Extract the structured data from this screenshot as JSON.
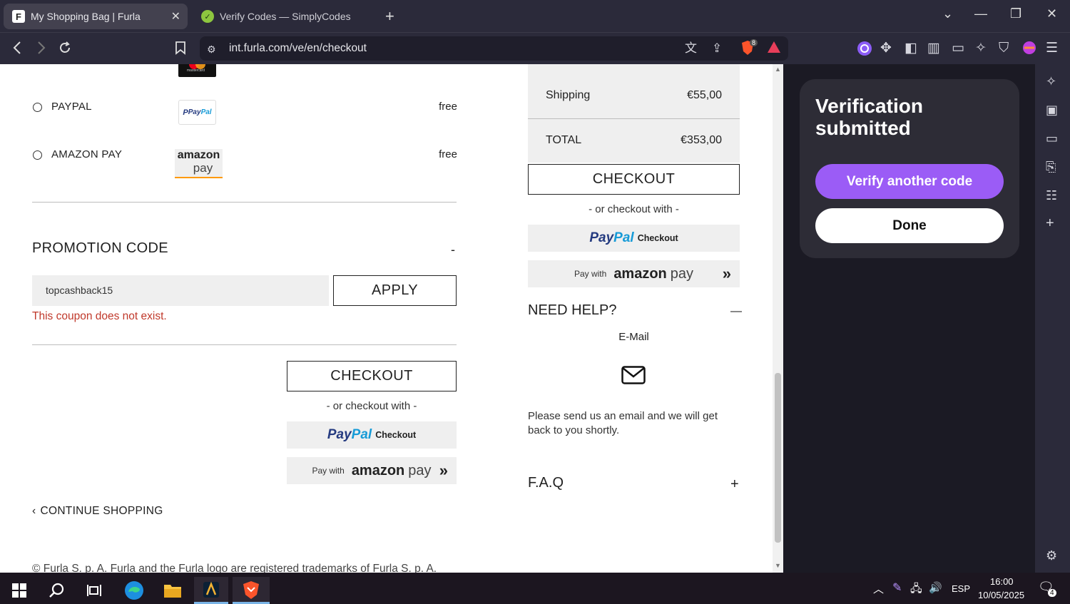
{
  "browser": {
    "tabs": [
      {
        "title": "My Shopping Bag | Furla",
        "favicon": "F"
      },
      {
        "title": "Verify Codes — SimplyCodes"
      }
    ],
    "url": "int.furla.com/ve/en/checkout",
    "shield_badge": "8"
  },
  "payment": {
    "methods": [
      {
        "label": "PAYPAL",
        "price": "free"
      },
      {
        "label": "AMAZON PAY",
        "price": "free"
      }
    ],
    "mastercard_text": "mastercard"
  },
  "promo": {
    "heading": "PROMOTION CODE",
    "collapse_symbol": "-",
    "input_value": "topcashback15",
    "apply_label": "APPLY",
    "error": "This coupon does not exist."
  },
  "checkout": {
    "button_label": "CHECKOUT",
    "or_text": "- or checkout with -",
    "paypal_logo_a": "Pay",
    "paypal_logo_b": "Pal",
    "paypal_checkout": "Checkout",
    "amazon_pay_with": "Pay with",
    "amazon_logo": "amazon",
    "amazon_pay": "pay",
    "amazon_arrows": "»"
  },
  "continue_shopping": "CONTINUE SHOPPING",
  "footer_text": "© Furla S. p. A. Furla and the Furla logo are registered trademarks of Furla S. p. A.",
  "summary": {
    "shipping_label": "Shipping",
    "shipping_value": "€55,00",
    "total_label": "TOTAL",
    "total_value": "€353,00"
  },
  "help": {
    "heading": "NEED HELP?",
    "collapse_symbol": "—",
    "email_label": "E-Mail",
    "email_text": "Please send us an email and we will get back to you shortly.",
    "faq_label": "F.A.Q",
    "faq_symbol": "+"
  },
  "sidepanel": {
    "title": "Verification submitted",
    "verify_another": "Verify another code",
    "done": "Done"
  },
  "taskbar": {
    "language": "ESP",
    "time": "16:00",
    "date": "10/05/2025",
    "notifications": "4"
  },
  "colors": {
    "accent_purple": "#9b5cf6",
    "error_red": "#c0392b",
    "paypal_blue": "#253b80",
    "paypal_light": "#179bd7",
    "amazon_orange": "#ff9900"
  }
}
